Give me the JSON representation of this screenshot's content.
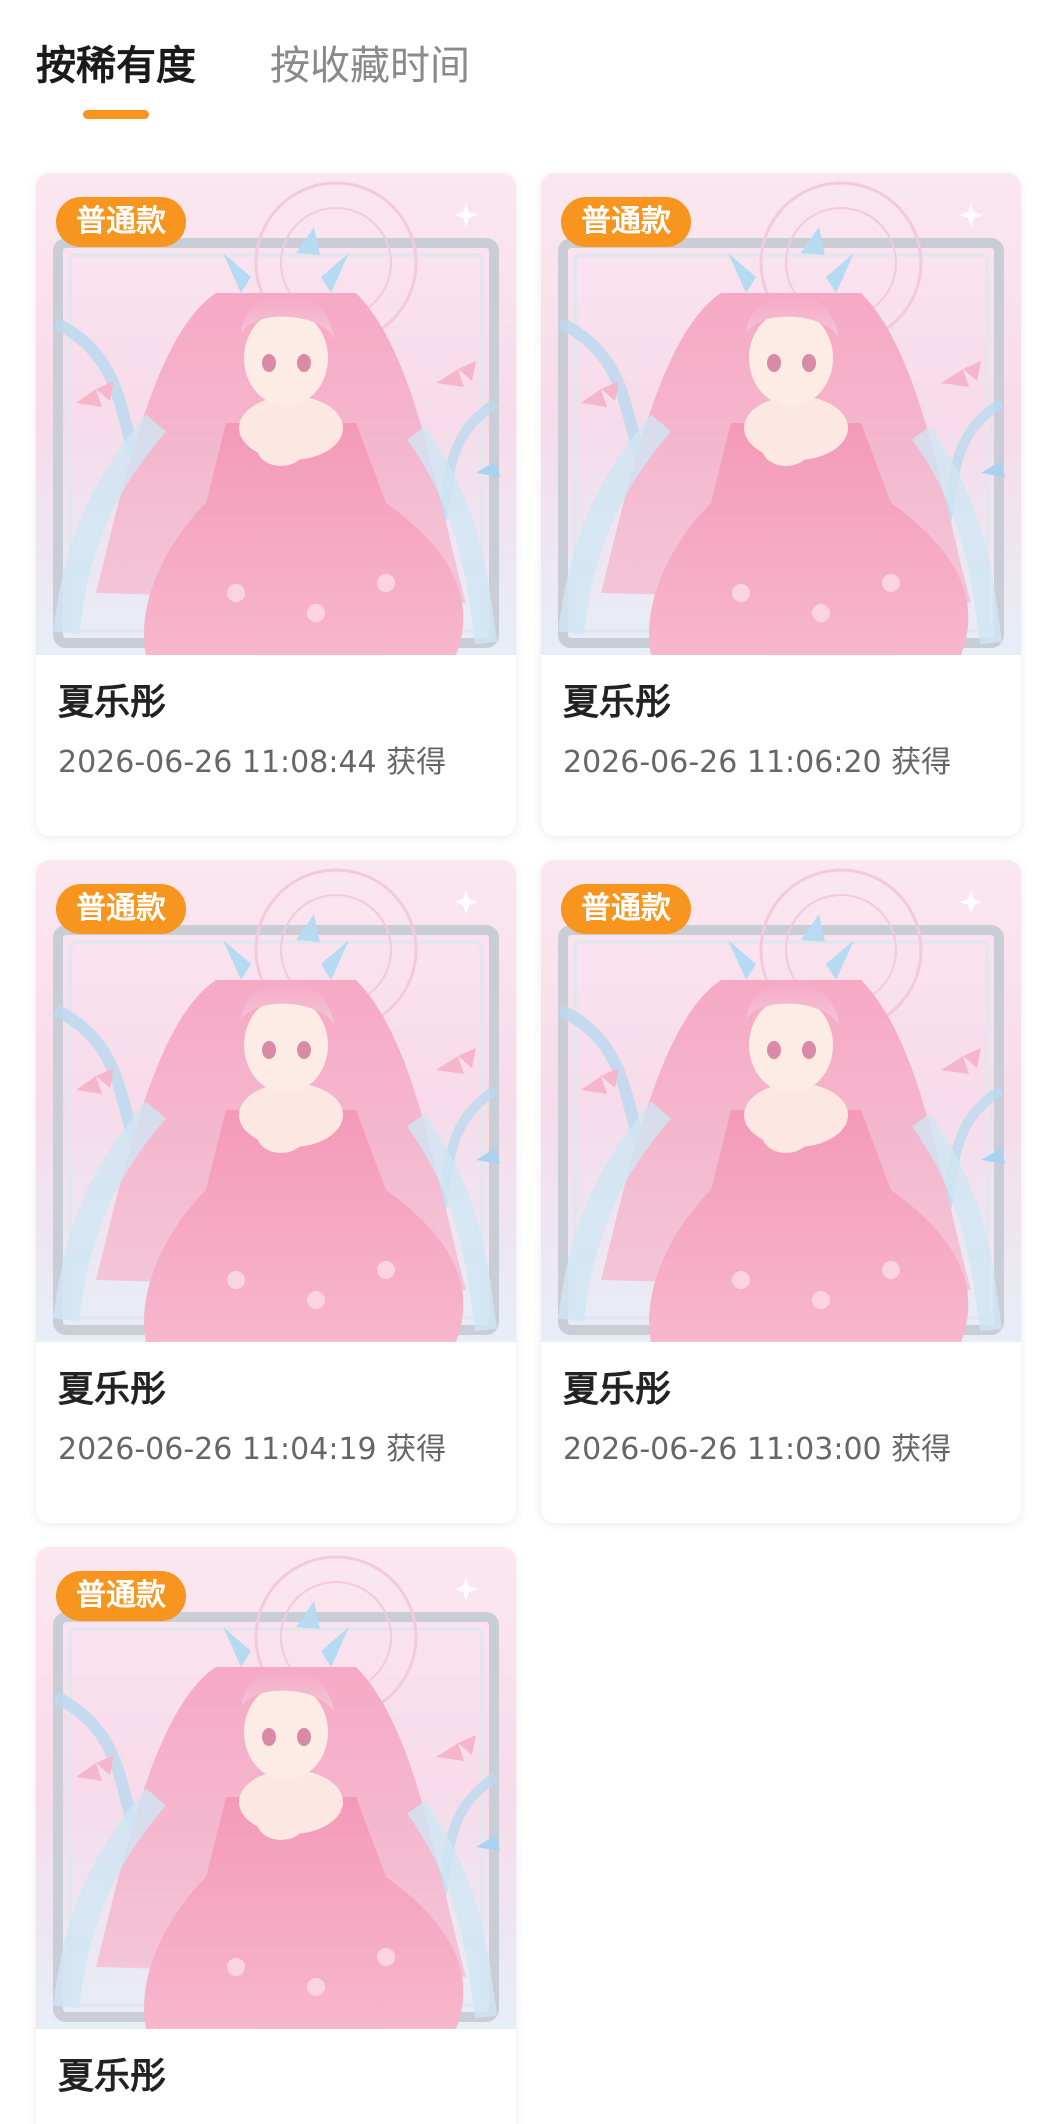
{
  "tabs": [
    {
      "label": "按稀有度",
      "active": true
    },
    {
      "label": "按收藏时间",
      "active": false
    }
  ],
  "accent_color": "#f7951e",
  "cards": [
    {
      "badge": "普通款",
      "name": "夏乐彤",
      "time": "2026-06-26 11:08:44 获得"
    },
    {
      "badge": "普通款",
      "name": "夏乐彤",
      "time": "2026-06-26 11:06:20 获得"
    },
    {
      "badge": "普通款",
      "name": "夏乐彤",
      "time": "2026-06-26 11:04:19 获得"
    },
    {
      "badge": "普通款",
      "name": "夏乐彤",
      "time": "2026-06-26 11:03:00 获得"
    },
    {
      "badge": "普通款",
      "name": "夏乐彤",
      "time": ""
    }
  ]
}
